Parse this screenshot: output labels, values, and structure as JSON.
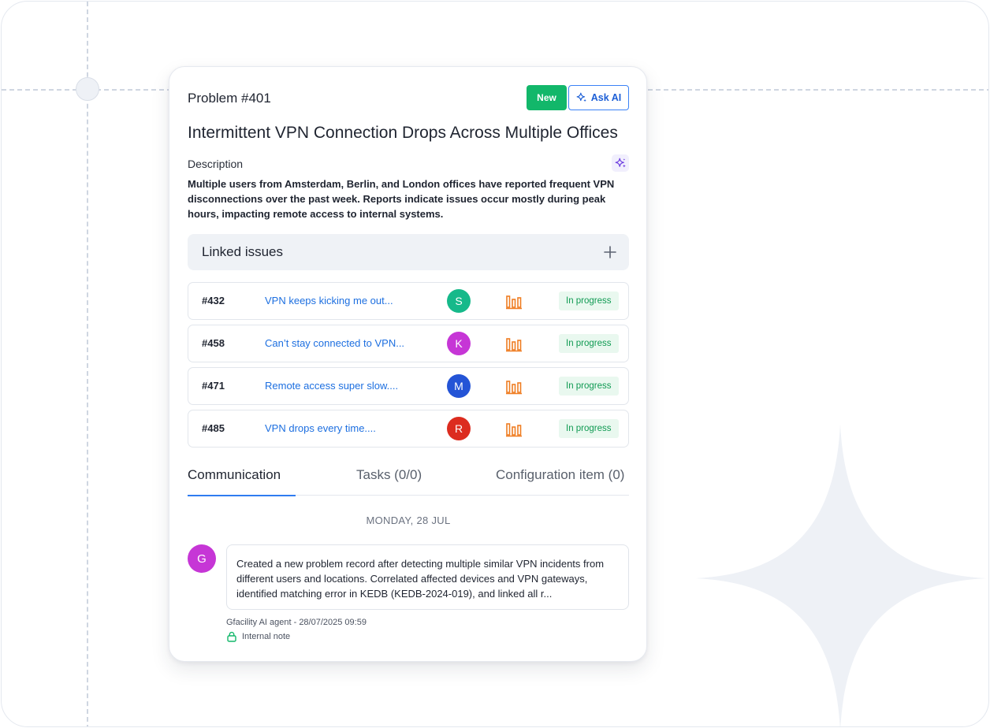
{
  "problem": {
    "id": "Problem #401",
    "status_button": "New",
    "ask_ai_button": "Ask AI",
    "title": "Intermittent VPN Connection Drops Across Multiple Offices",
    "description_label": "Description",
    "description": "Multiple users from Amsterdam, Berlin, and London offices have reported frequent VPN disconnections over the past week. Reports indicate issues occur mostly during peak hours, impacting remote access to internal systems."
  },
  "linked_issues": {
    "title": "Linked issues",
    "add_icon": "plus-icon",
    "items": [
      {
        "id": "#432",
        "summary": "VPN keeps kicking me out...",
        "avatar_initial": "S",
        "avatar_color": "#16b98a",
        "priority_icon": "priority-bars-icon",
        "status": "In progress"
      },
      {
        "id": "#458",
        "summary": "Can’t stay connected to VPN...",
        "avatar_initial": "K",
        "avatar_color": "#c636d6",
        "priority_icon": "priority-bars-icon",
        "status": "In progress"
      },
      {
        "id": "#471",
        "summary": "Remote access super slow....",
        "avatar_initial": "M",
        "avatar_color": "#2454d6",
        "priority_icon": "priority-bars-icon",
        "status": "In progress"
      },
      {
        "id": "#485",
        "summary": "VPN drops every time....",
        "avatar_initial": "R",
        "avatar_color": "#dc2c1f",
        "priority_icon": "priority-bars-icon",
        "status": "In progress"
      }
    ]
  },
  "tabs": [
    {
      "label": "Communication",
      "active": true
    },
    {
      "label": "Tasks (0/0)",
      "active": false
    },
    {
      "label": "Configuration item (0)",
      "active": false
    }
  ],
  "communication": {
    "date": "MONDAY, 28 JUL",
    "author_initial": "G",
    "message": "Created a new problem record after detecting multiple similar VPN incidents from different users and locations. Correlated affected devices and VPN gateways, identified matching error in KEDB (KEDB-2024-019), and linked all r...",
    "meta": "Gfacility AI agent - 28/07/2025 09:59",
    "note_label": "Internal note",
    "note_icon": "lock-icon"
  },
  "colors": {
    "new_button": "#12b76a",
    "accent_blue": "#2f7cf0",
    "priority_orange": "#ef7d22",
    "status_green": "#0f9a52"
  }
}
